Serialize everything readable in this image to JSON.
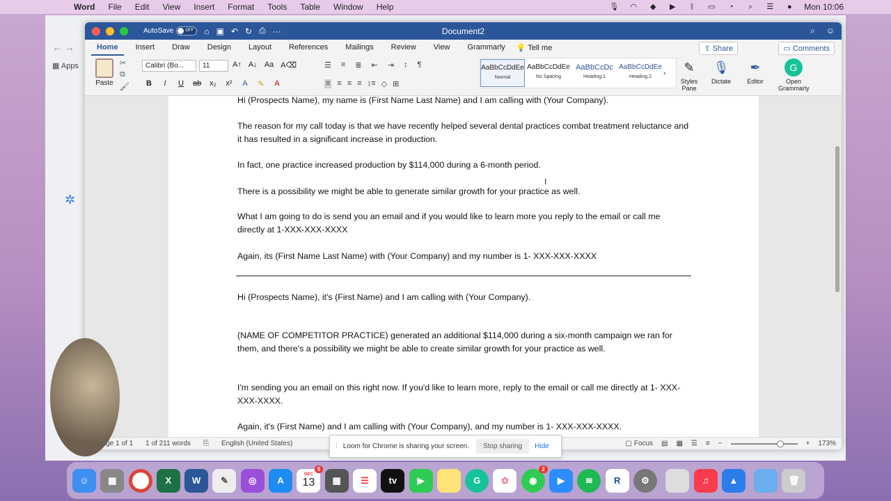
{
  "menubar": {
    "app": "Word",
    "items": [
      "File",
      "Edit",
      "View",
      "Insert",
      "Format",
      "Tools",
      "Table",
      "Window",
      "Help"
    ],
    "clock": "Mon 10:06"
  },
  "chrome": {
    "apps_label": "Apps"
  },
  "window": {
    "title": "Document2",
    "autosave_label": "AutoSave",
    "autosave_state": "OFF"
  },
  "ribbon_tabs": [
    "Home",
    "Insert",
    "Draw",
    "Design",
    "Layout",
    "References",
    "Mailings",
    "Review",
    "View",
    "Grammarly"
  ],
  "tell_me": "Tell me",
  "share_label": "Share",
  "comments_label": "Comments",
  "ribbon": {
    "paste_label": "Paste",
    "font_name": "Calibri (Bo...",
    "font_size": "11",
    "styles": [
      {
        "sample": "AaBbCcDdEe",
        "name": "Normal"
      },
      {
        "sample": "AaBbCcDdEe",
        "name": "No Spacing"
      },
      {
        "sample": "AaBbCcDc",
        "name": "Heading 1"
      },
      {
        "sample": "AaBbCcDdEe",
        "name": "Heading 2"
      }
    ],
    "styles_pane": "Styles Pane",
    "dictate": "Dictate",
    "editor": "Editor",
    "open_grammarly": "Open Grammarly"
  },
  "document": {
    "paragraphs": [
      "Hi (Prospects Name), my name is (First Name Last Name) and I am calling with (Your Company).",
      "The reason for my call today is that we have recently helped several dental practices combat treatment reluctance and it has resulted in a significant increase in production.",
      "In fact, one practice increased production by $114,000 during a 6-month period.",
      "There is a possibility we might be able to generate similar growth for your practice as well.",
      "What I am going to do is send you an email and if you would like to learn more you reply to the email or call me directly at 1-XXX-XXX-XXXX",
      "Again, its (First Name Last Name) with (Your Company) and my number is 1- XXX-XXX-XXXX",
      "Hi (Prospects Name), it's (First Name) and I am calling with (Your Company).",
      "(NAME OF COMPETITOR PRACTICE) generated an additional $114,000 during a six-month campaign we ran for them, and there's a possibility we might be able to create similar growth for your practice as well.",
      "I'm sending you an email on this right now. If you'd like to learn more, reply to the email or call me directly at 1- XXX-XXX-XXXX.",
      "Again, it's (First Name) and I am calling with (Your Company), and my number is 1- XXX-XXX-XXXX."
    ]
  },
  "status": {
    "page": "Page 1 of 1",
    "words": "1 of 211 words",
    "language": "English (United States)",
    "focus": "Focus",
    "zoom": "173%"
  },
  "loom": {
    "message": "Loom for Chrome is sharing your screen.",
    "stop": "Stop sharing",
    "hide": "Hide"
  },
  "dock": {
    "calendar_month": "DEC",
    "calendar_day": "13",
    "calendar_badge": "5",
    "messages_badge": "2"
  }
}
